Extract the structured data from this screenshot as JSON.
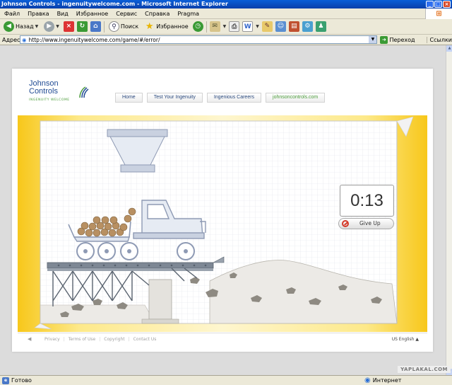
{
  "window": {
    "title": "Johnson Controls - ingenuitywelcome.com - Microsoft Internet Explorer"
  },
  "menu": {
    "items": [
      "Файл",
      "Правка",
      "Вид",
      "Избранное",
      "Сервис",
      "Справка",
      "Pragma"
    ]
  },
  "toolbar": {
    "back_label": "Назад",
    "search_label": "Поиск",
    "favorites_label": "Избранное"
  },
  "address": {
    "label": "Адрес",
    "url": "http://www.ingenuitywelcome.com/game/#/error/",
    "go_label": "Переход",
    "links_label": "Ссылки"
  },
  "site": {
    "logo_line1": "Johnson",
    "logo_line2": "Controls",
    "tagline": "INGENUITY WELCOME",
    "nav": [
      "Home",
      "Test Your Ingenuity",
      "Ingenious Careers",
      "johnsoncontrols.com"
    ],
    "timer": "0:13",
    "give_up_label": "Give Up",
    "footer_links": [
      "Privacy",
      "Terms of Use",
      "Copyright",
      "Contact Us"
    ],
    "language": "US English ▲"
  },
  "status": {
    "ready": "Готово",
    "zone": "Интернет",
    "watermark": "YAPLAKAL.COM"
  },
  "colors": {
    "accent_blue": "#1f4a93",
    "accent_green": "#4b9c3a",
    "yellow": "#f7c71a"
  }
}
